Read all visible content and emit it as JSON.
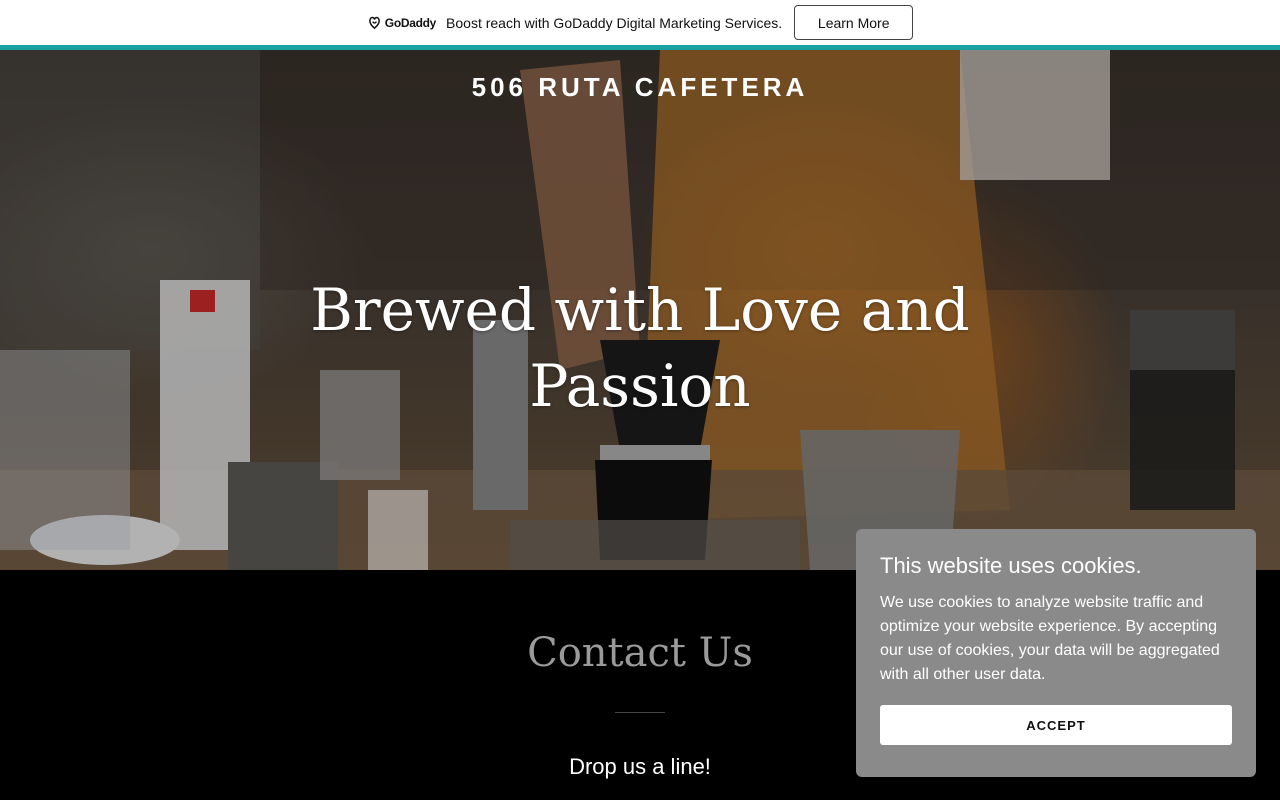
{
  "promo": {
    "logo_text": "GoDaddy",
    "message": "Boost reach with GoDaddy Digital Marketing Services.",
    "button_label": "Learn More",
    "accent_color": "#1ba0a0"
  },
  "hero": {
    "site_title": "506 RUTA CAFETERA",
    "headline": "Brewed with Love and Passion"
  },
  "contact": {
    "title": "Contact Us",
    "subtitle": "Drop us a line!"
  },
  "cookie_banner": {
    "title": "This website uses cookies.",
    "body": "We use cookies to analyze website traffic and optimize your website experience. By accepting our use of cookies, your data will be aggregated with all other user data.",
    "accept_label": "ACCEPT"
  }
}
